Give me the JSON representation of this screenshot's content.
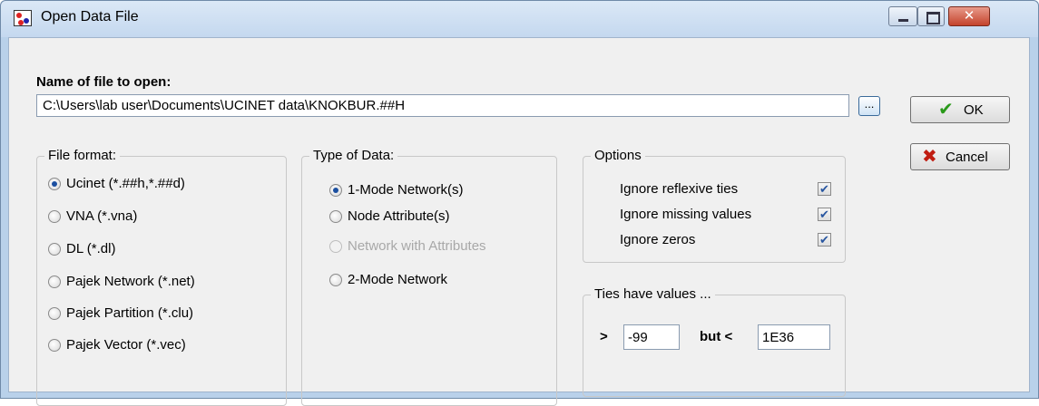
{
  "window": {
    "title": "Open Data File"
  },
  "file": {
    "label": "Name of file to open:",
    "path": "C:\\Users\\lab user\\Documents\\UCINET data\\KNOKBUR.##H",
    "browse_label": "..."
  },
  "buttons": {
    "ok": "OK",
    "cancel": "Cancel"
  },
  "file_format": {
    "title": "File format:",
    "options": [
      {
        "label": "Ucinet (*.##h,*.##d)",
        "checked": true
      },
      {
        "label": "VNA (*.vna)",
        "checked": false
      },
      {
        "label": "DL (*.dl)",
        "checked": false
      },
      {
        "label": "Pajek Network (*.net)",
        "checked": false
      },
      {
        "label": "Pajek Partition (*.clu)",
        "checked": false
      },
      {
        "label": "Pajek Vector (*.vec)",
        "checked": false
      }
    ]
  },
  "data_type": {
    "title": "Type of Data:",
    "options": [
      {
        "label": "1-Mode Network(s)",
        "checked": true,
        "enabled": true
      },
      {
        "label": "Node Attribute(s)",
        "checked": false,
        "enabled": true
      },
      {
        "label": "Network with Attributes",
        "checked": false,
        "enabled": false
      },
      {
        "label": "2-Mode Network",
        "checked": false,
        "enabled": true
      }
    ]
  },
  "options": {
    "title": "Options",
    "items": [
      {
        "label": "Ignore reflexive ties",
        "checked": true
      },
      {
        "label": "Ignore missing values",
        "checked": true
      },
      {
        "label": "Ignore zeros",
        "checked": true
      }
    ]
  },
  "ties": {
    "title": "Ties have values ...",
    "gt_label": ">",
    "low_value": "-99",
    "but_label": "but <",
    "high_value": "1E36"
  },
  "colors": {
    "accent": "#1b4fa0",
    "ok_check": "#2a9a1a",
    "cancel_x": "#c01d12"
  },
  "icons": {
    "app": "ucinet-app-icon",
    "ok": "checkmark-icon",
    "cancel": "x-icon"
  }
}
